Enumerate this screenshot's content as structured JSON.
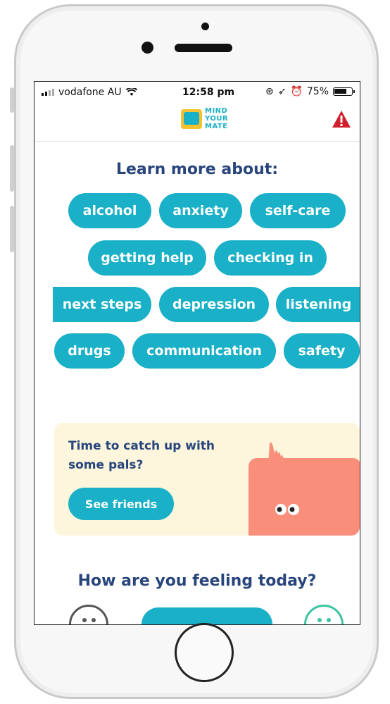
{
  "status_bar": {
    "carrier": "vodafone AU",
    "time": "12:58 pm",
    "battery": "75%",
    "battery_level": 0.75
  },
  "header": {
    "logo_lines": [
      "MIND",
      "YOUR",
      "MATE"
    ],
    "alert_icon": "warning-icon"
  },
  "learn": {
    "title": "Learn more about:",
    "topics": [
      "alcohol",
      "anxiety",
      "self-care",
      "getting help",
      "checking in",
      "next steps",
      "depression",
      "listening",
      "drugs",
      "communication",
      "safety"
    ]
  },
  "card": {
    "text": "Time to catch up with some pals?",
    "button_label": "See friends"
  },
  "feeling": {
    "title": "How are you feeling today?"
  },
  "colors": {
    "accent": "#1ab0c7",
    "title": "#28457c",
    "card_bg": "#fdf6dc",
    "alert": "#d0202e",
    "creature": "#f98f7b"
  }
}
